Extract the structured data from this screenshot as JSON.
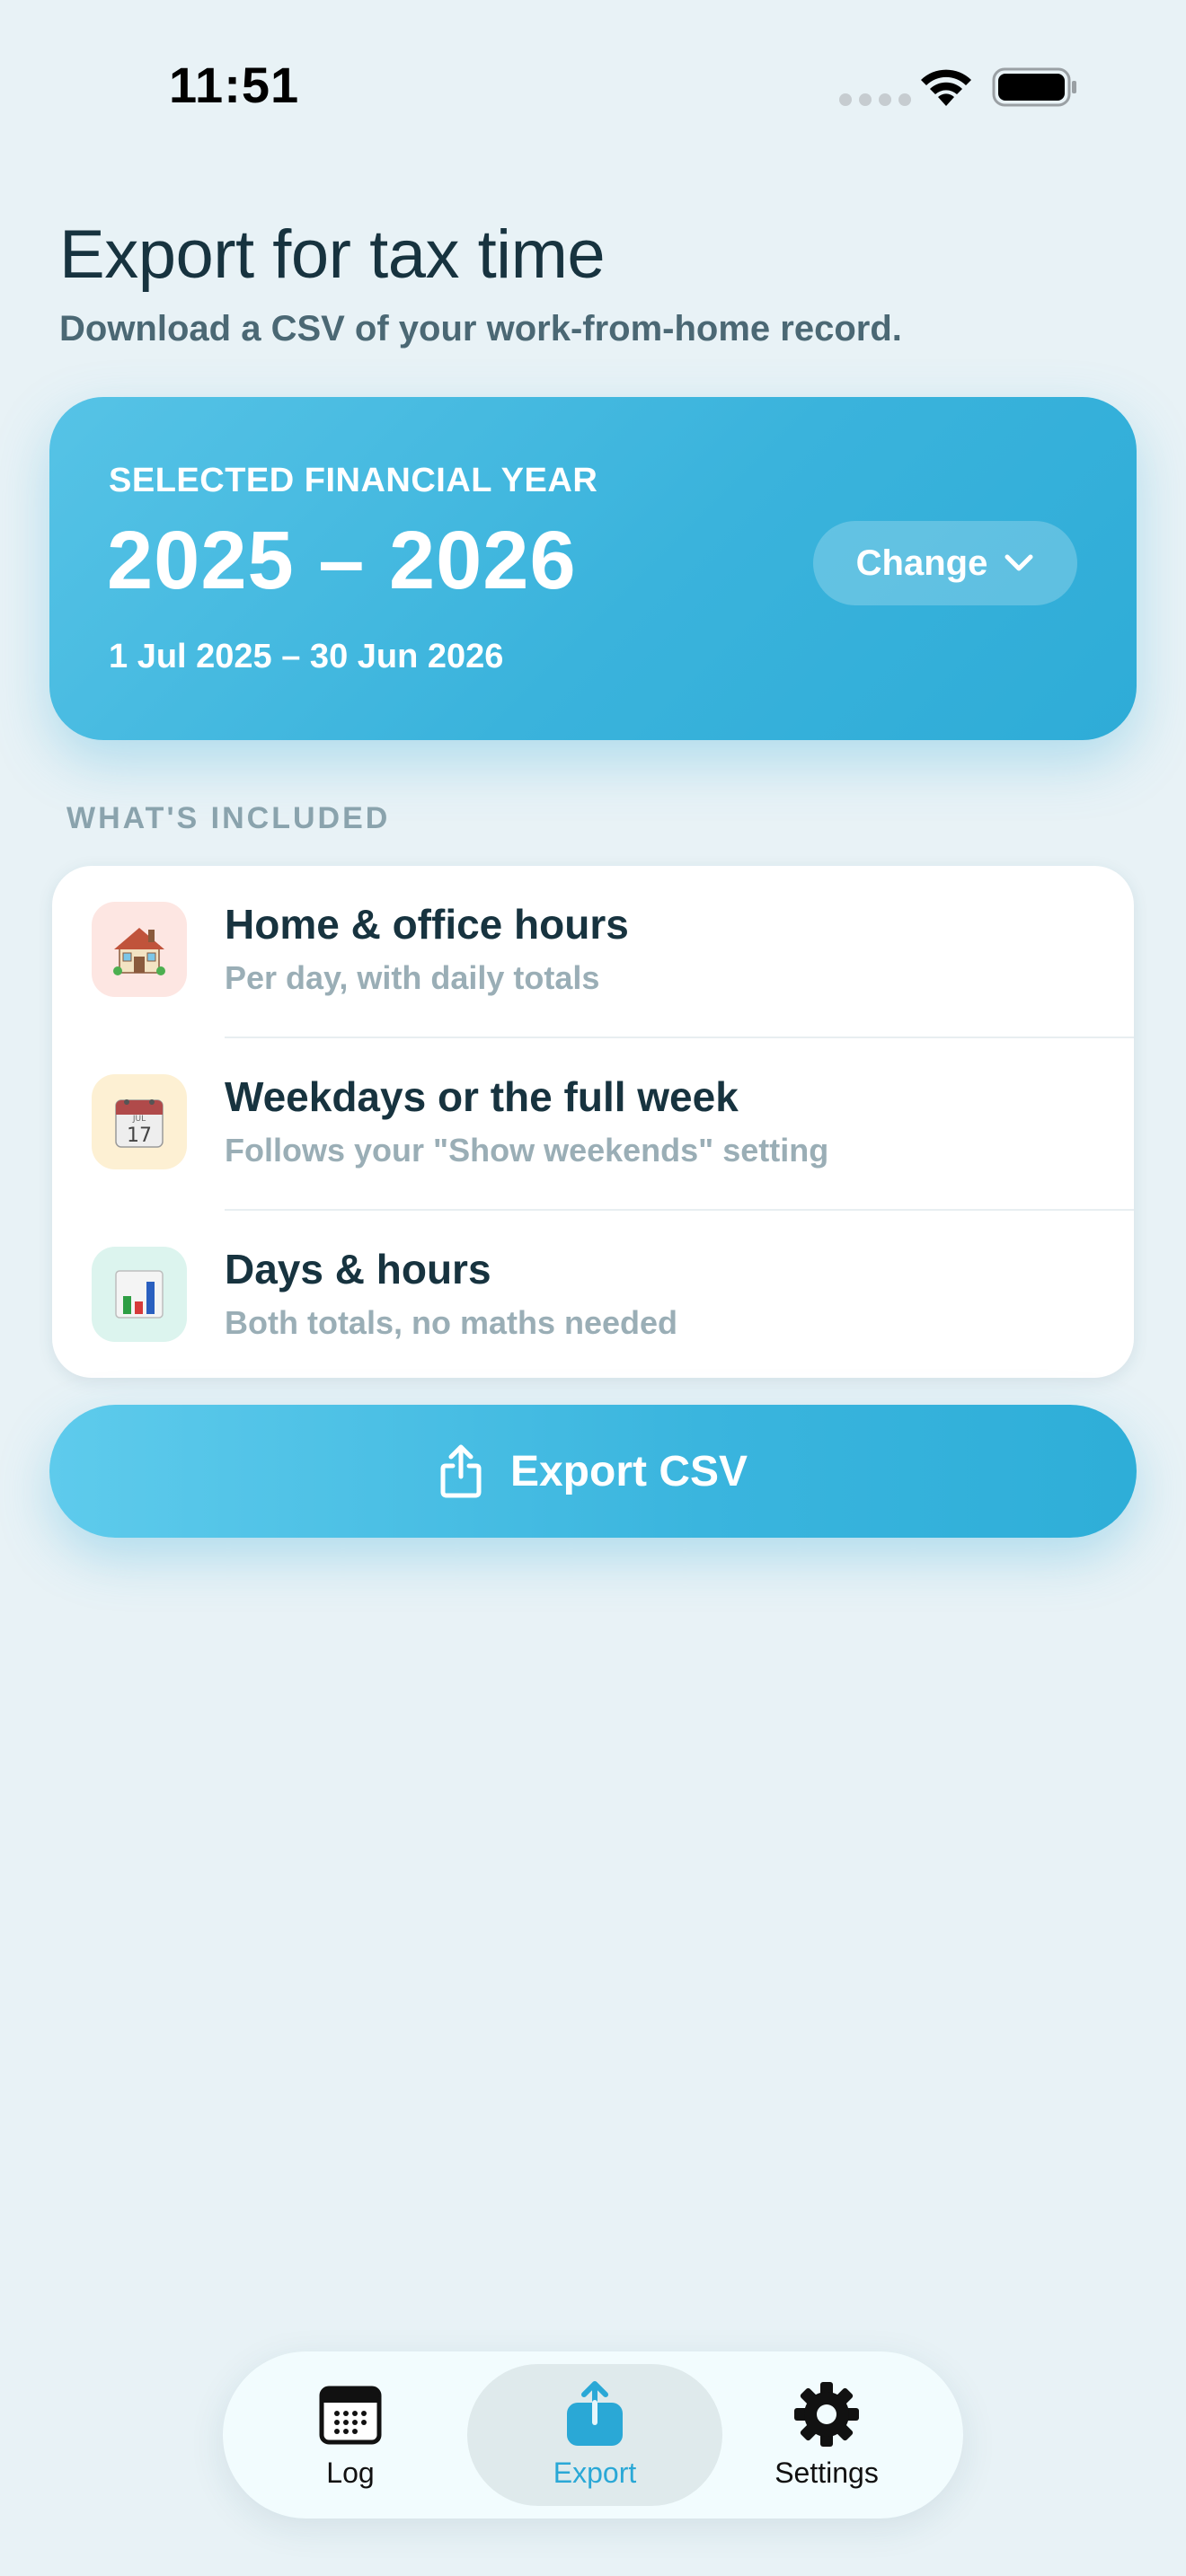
{
  "status_bar": {
    "time": "11:51"
  },
  "header": {
    "title": "Export for tax time",
    "subtitle": "Download a CSV of your work-from-home record."
  },
  "financial_year": {
    "label": "SELECTED FINANCIAL YEAR",
    "range": "2025 – 2026",
    "dates": "1 Jul 2025 – 30 Jun 2026",
    "change_label": "Change"
  },
  "included": {
    "section_label": "WHAT'S INCLUDED",
    "items": [
      {
        "icon": "house-icon",
        "title": "Home & office hours",
        "subtitle": "Per day, with daily totals",
        "tint": "#fde6e2"
      },
      {
        "icon": "calendar-icon",
        "title": "Weekdays or the full week",
        "subtitle": "Follows your \"Show weekends\" setting",
        "tint": "#fdf0d3"
      },
      {
        "icon": "bar-chart-icon",
        "title": "Days & hours",
        "subtitle": "Both totals, no maths needed",
        "tint": "#dcf4ee"
      }
    ]
  },
  "export_button": {
    "label": "Export CSV",
    "icon": "share-icon"
  },
  "tab_bar": {
    "tabs": [
      {
        "label": "Log",
        "icon": "calendar-grid-icon",
        "selected": false
      },
      {
        "label": "Export",
        "icon": "export-icon",
        "selected": true
      },
      {
        "label": "Settings",
        "icon": "gear-icon",
        "selected": false
      }
    ]
  },
  "colors": {
    "accent": "#3ab5de",
    "background": "#e8f2f6",
    "title_text": "#17333f",
    "muted_text": "#9aaeb6"
  }
}
